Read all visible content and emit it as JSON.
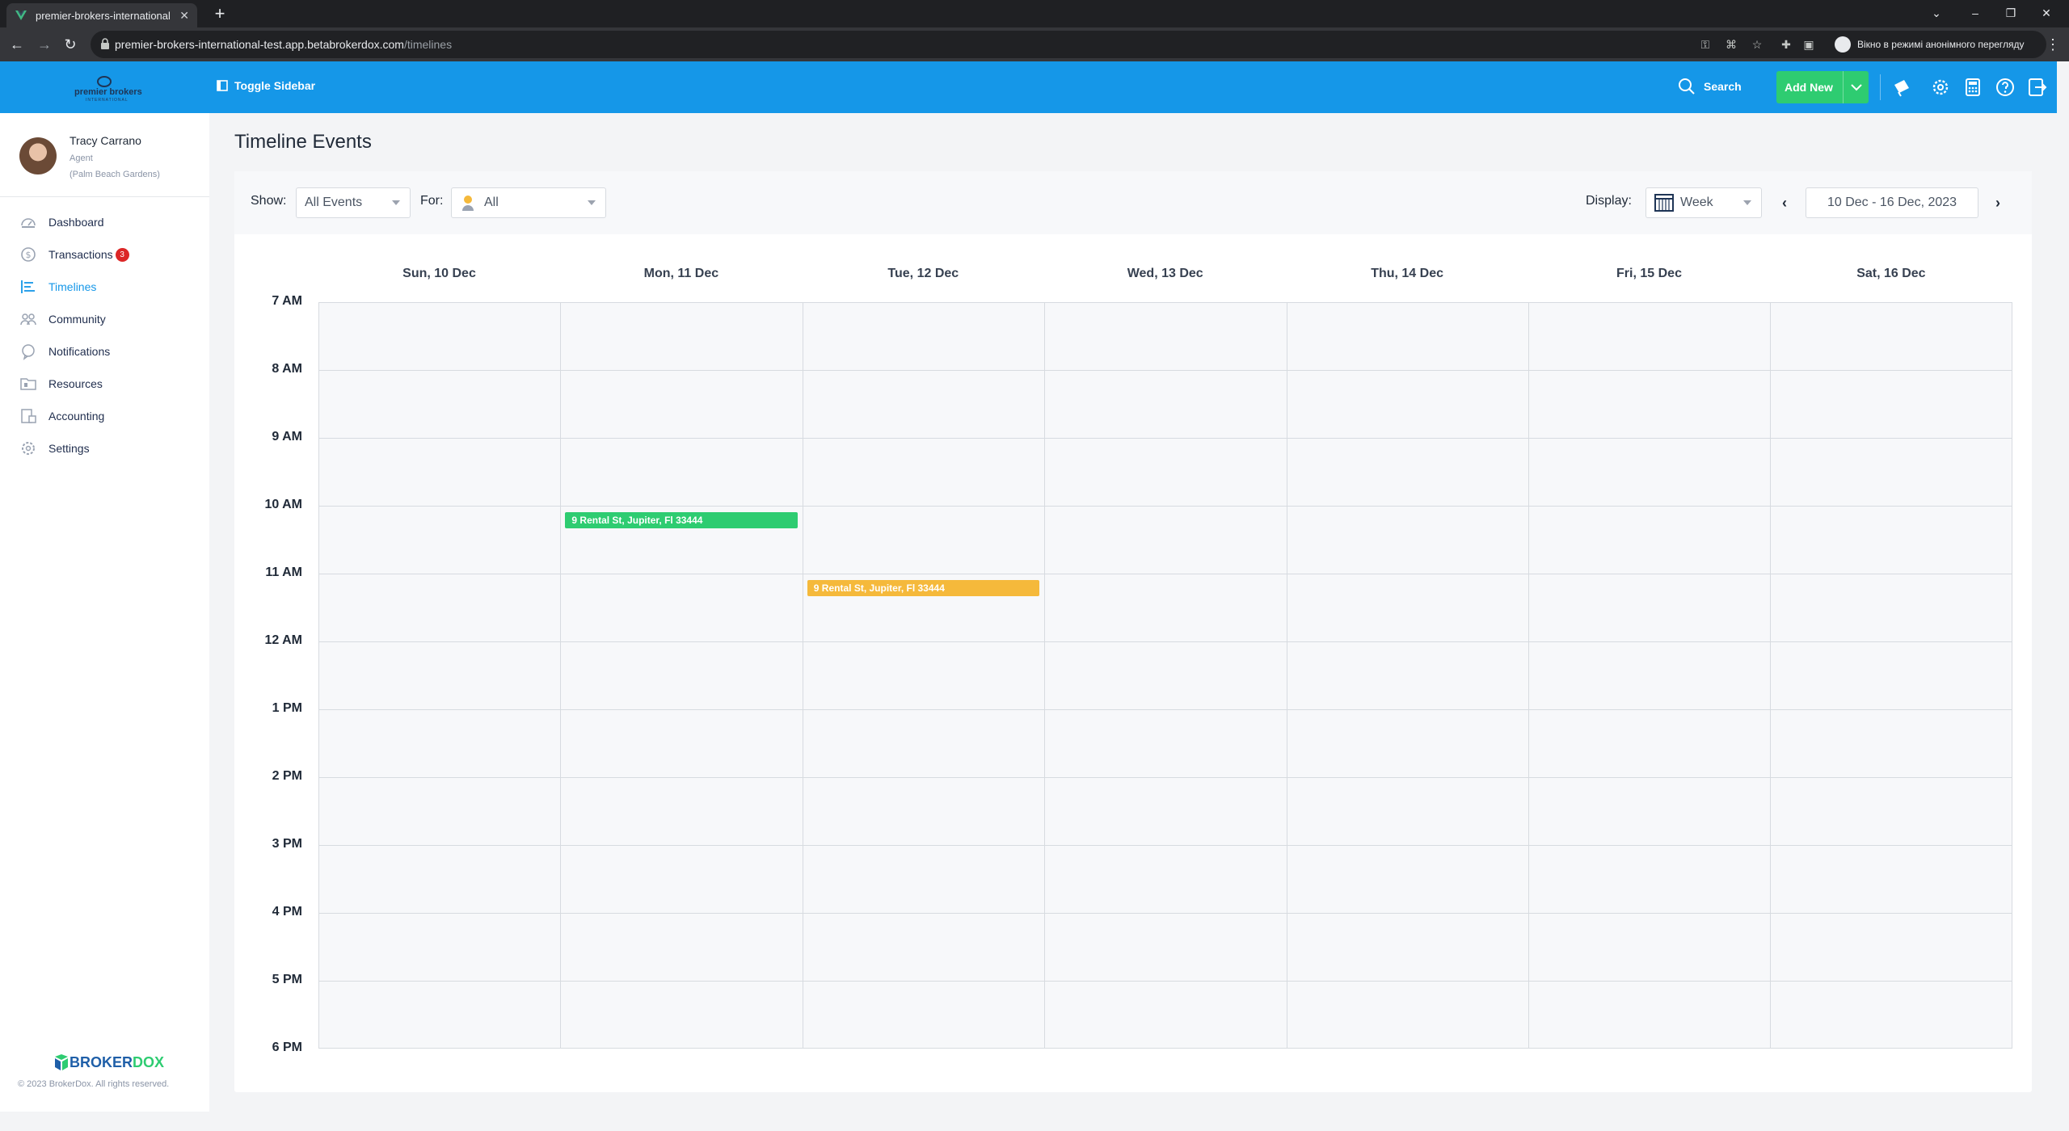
{
  "browser": {
    "tab_title": "premier-brokers-international",
    "url_host": "premier-brokers-international-test.app.betabrokerdox.com",
    "url_path": "/timelines",
    "incognito_label": "Вікно в режимі анонімного перегляду"
  },
  "header": {
    "logo_text": "premier brokers",
    "logo_sub": "INTERNATIONAL",
    "toggle_sidebar": "Toggle Sidebar",
    "search": "Search",
    "add_new": "Add New",
    "accent": "#1597e8",
    "add_new_color": "#2ecc71"
  },
  "user": {
    "name": "Tracy Carrano",
    "role": "Agent",
    "office": "(Palm Beach Gardens)"
  },
  "sidebar": {
    "items": [
      {
        "label": "Dashboard",
        "icon": "dashboard-icon"
      },
      {
        "label": "Transactions",
        "icon": "dollar-icon",
        "badge": "3"
      },
      {
        "label": "Timelines",
        "icon": "timeline-icon",
        "active": true
      },
      {
        "label": "Community",
        "icon": "community-icon"
      },
      {
        "label": "Notifications",
        "icon": "bell-icon"
      },
      {
        "label": "Resources",
        "icon": "folder-icon"
      },
      {
        "label": "Accounting",
        "icon": "accounting-icon"
      },
      {
        "label": "Settings",
        "icon": "gear-icon"
      }
    ],
    "brand_part1": "BROKER",
    "brand_part2": "DOX",
    "copyright": "© 2023 BrokerDox. All rights reserved."
  },
  "page": {
    "title": "Timeline Events"
  },
  "filters": {
    "show_label": "Show:",
    "show_value": "All Events",
    "for_label": "For:",
    "for_value": "All",
    "display_label": "Display:",
    "display_value": "Week",
    "date_range": "10 Dec - 16 Dec, 2023"
  },
  "calendar": {
    "days": [
      "Sun, 10 Dec",
      "Mon, 11 Dec",
      "Tue, 12 Dec",
      "Wed, 13 Dec",
      "Thu, 14 Dec",
      "Fri, 15 Dec",
      "Sat, 16 Dec"
    ],
    "hours": [
      "7 AM",
      "8 AM",
      "9 AM",
      "10 AM",
      "11 AM",
      "12 AM",
      "1 PM",
      "2 PM",
      "3 PM",
      "4 PM",
      "5 PM",
      "6 PM"
    ],
    "events": [
      {
        "title": "9 Rental St, Jupiter, Fl 33444",
        "day": 1,
        "hour": 3,
        "color": "#2ecc71"
      },
      {
        "title": "9 Rental St, Jupiter, Fl 33444",
        "day": 2,
        "hour": 4,
        "color": "#f5b93b"
      }
    ]
  }
}
